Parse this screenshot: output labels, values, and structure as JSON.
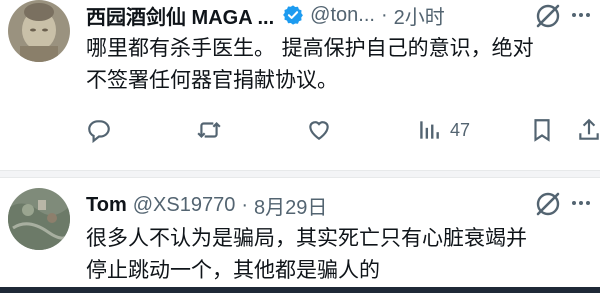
{
  "tweets": [
    {
      "display_name": "西园酒剑仙 MAGA ...",
      "verified": true,
      "handle": "@ton...",
      "separator": "·",
      "time": "2小时",
      "text_lines": [
        "哪里都有杀手医生。 提高保护自己的意识，绝对",
        "不签署任何器官捐献协议。"
      ],
      "actions": {
        "views_count": "47"
      }
    },
    {
      "display_name": "Tom",
      "verified": false,
      "handle": "@XS19770",
      "separator": "·",
      "time": "8月29日",
      "text_lines": [
        "很多人不认为是骗局，其实死亡只有心脏衰竭并",
        "停止跳动一个，其他都是骗人的"
      ]
    }
  ],
  "icons": {
    "verified": "verified-badge-icon",
    "grok": "grok-icon",
    "more": "more-icon",
    "reply": "reply-icon",
    "retweet": "retweet-icon",
    "like": "like-icon",
    "views": "views-icon",
    "bookmark": "bookmark-icon",
    "share": "share-icon"
  },
  "colors": {
    "text": "#0f1419",
    "secondary": "#536471",
    "verified": "#1d9bf0"
  }
}
